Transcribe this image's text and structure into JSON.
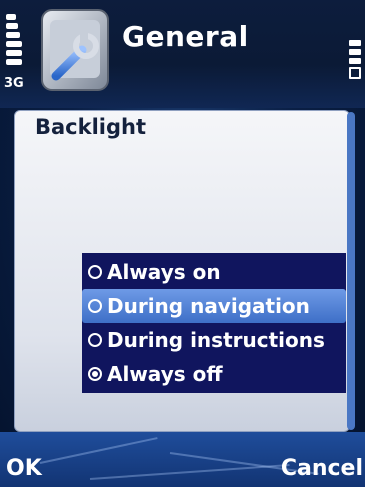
{
  "status": {
    "network": "3G"
  },
  "header": {
    "title": "General",
    "icon": "settings-tools-icon"
  },
  "setting": {
    "label": "Backlight"
  },
  "options": [
    {
      "label": "Always on",
      "selected": false,
      "highlighted": false
    },
    {
      "label": "During navigation",
      "selected": false,
      "highlighted": true
    },
    {
      "label": "During instructions",
      "selected": false,
      "highlighted": false
    },
    {
      "label": "Always off",
      "selected": true,
      "highlighted": false
    }
  ],
  "softkeys": {
    "left": "OK",
    "right": "Cancel"
  }
}
